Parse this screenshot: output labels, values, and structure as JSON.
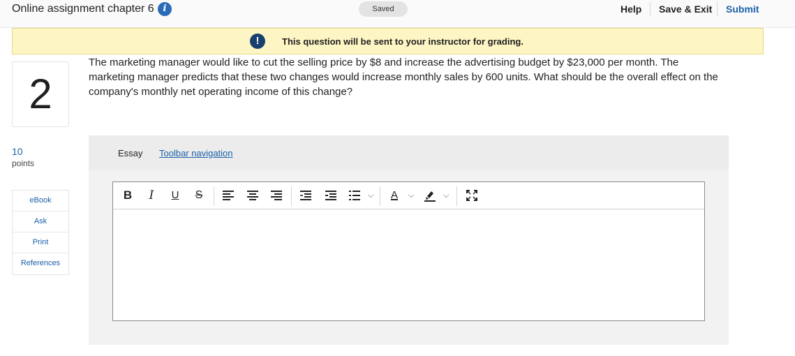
{
  "header": {
    "title": "Online assignment chapter 6",
    "info_icon": "i",
    "saved_label": "Saved",
    "help_label": "Help",
    "save_exit_label": "Save & Exit",
    "submit_label": "Submit"
  },
  "banner": {
    "icon": "!",
    "text": "This question will be sent to your instructor for grading."
  },
  "question": {
    "number": "2",
    "points_value": "10",
    "points_label": "points",
    "text": "The marketing manager would like to cut the selling price by $8 and increase the advertising budget by $23,000 per month. The marketing manager predicts that these two changes would increase monthly sales by 600 units. What should be the overall effect on the company's monthly net operating income of this change?"
  },
  "side_links": [
    {
      "label": "eBook"
    },
    {
      "label": "Ask"
    },
    {
      "label": "Print"
    },
    {
      "label": "References"
    }
  ],
  "essay": {
    "label": "Essay",
    "toolbar_nav_link": "Toolbar navigation ",
    "editor_value": ""
  },
  "toolbar": {
    "bold": "B",
    "italic": "I",
    "underline": "U",
    "strike": "S",
    "font_color": "A",
    "chevron": "⌵"
  },
  "icons": {
    "bold": "bold-icon",
    "italic": "italic-icon",
    "underline": "underline-icon",
    "strikethrough": "strikethrough-icon",
    "align_left": "align-left-icon",
    "align_center": "align-center-icon",
    "align_right": "align-right-icon",
    "outdent": "outdent-icon",
    "indent": "indent-icon",
    "bullet_list": "bullet-list-icon",
    "font_color": "font-color-icon",
    "highlight": "highlight-icon",
    "fullscreen": "fullscreen-icon"
  },
  "colors": {
    "accent": "#1a5fa8",
    "banner_bg": "#fdf6c4",
    "banner_icon": "#18406e",
    "info_icon": "#2b6cb8"
  }
}
